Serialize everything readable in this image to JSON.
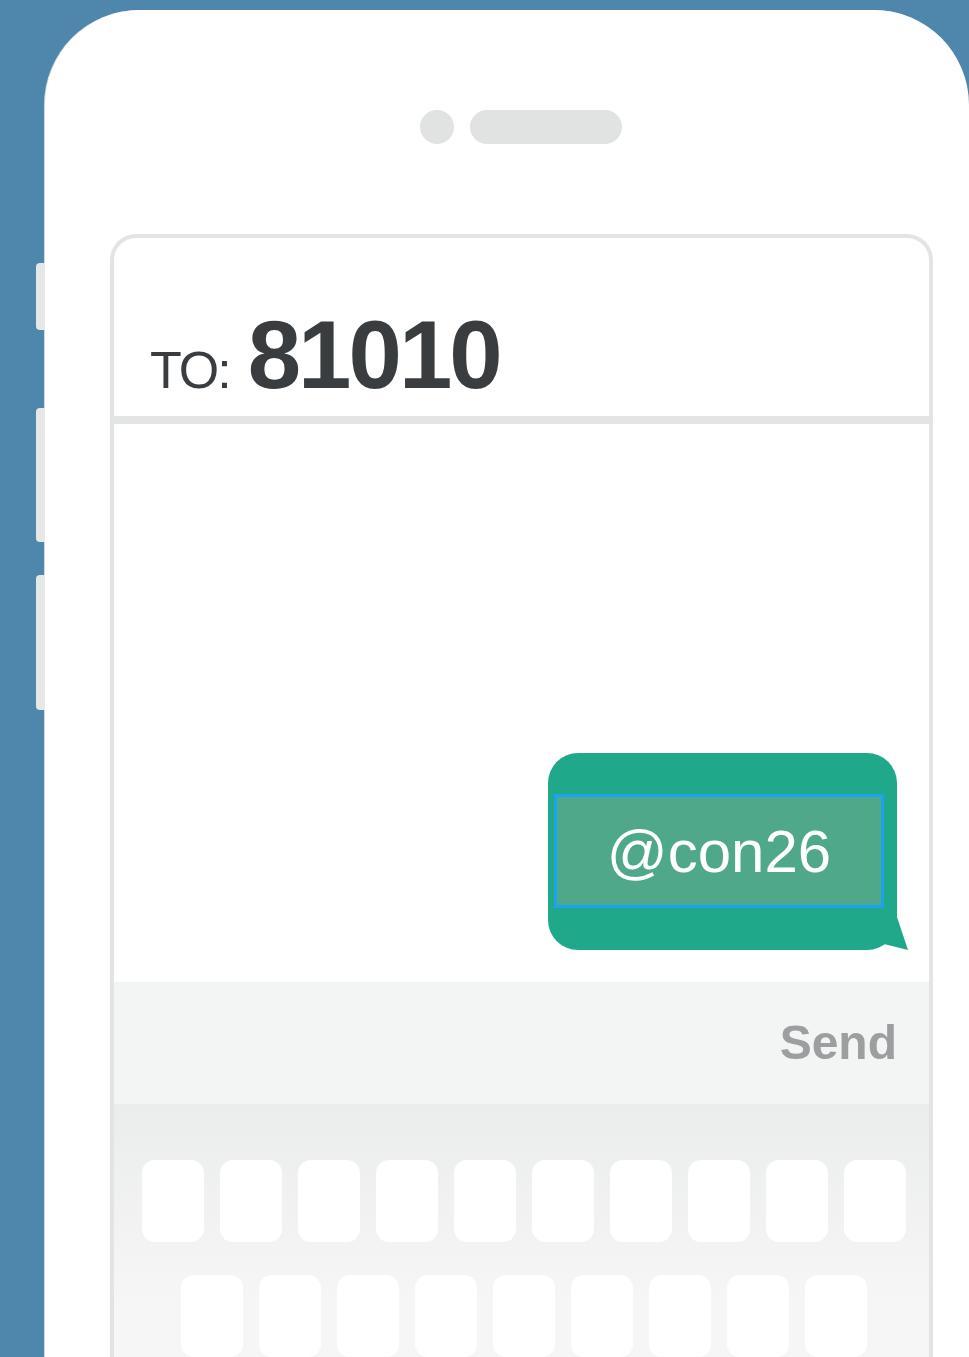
{
  "recipient": {
    "label": "TO:",
    "number": "81010"
  },
  "messages": [
    {
      "text": "@con26",
      "selected": true
    }
  ],
  "send_button": {
    "label": "Send"
  }
}
